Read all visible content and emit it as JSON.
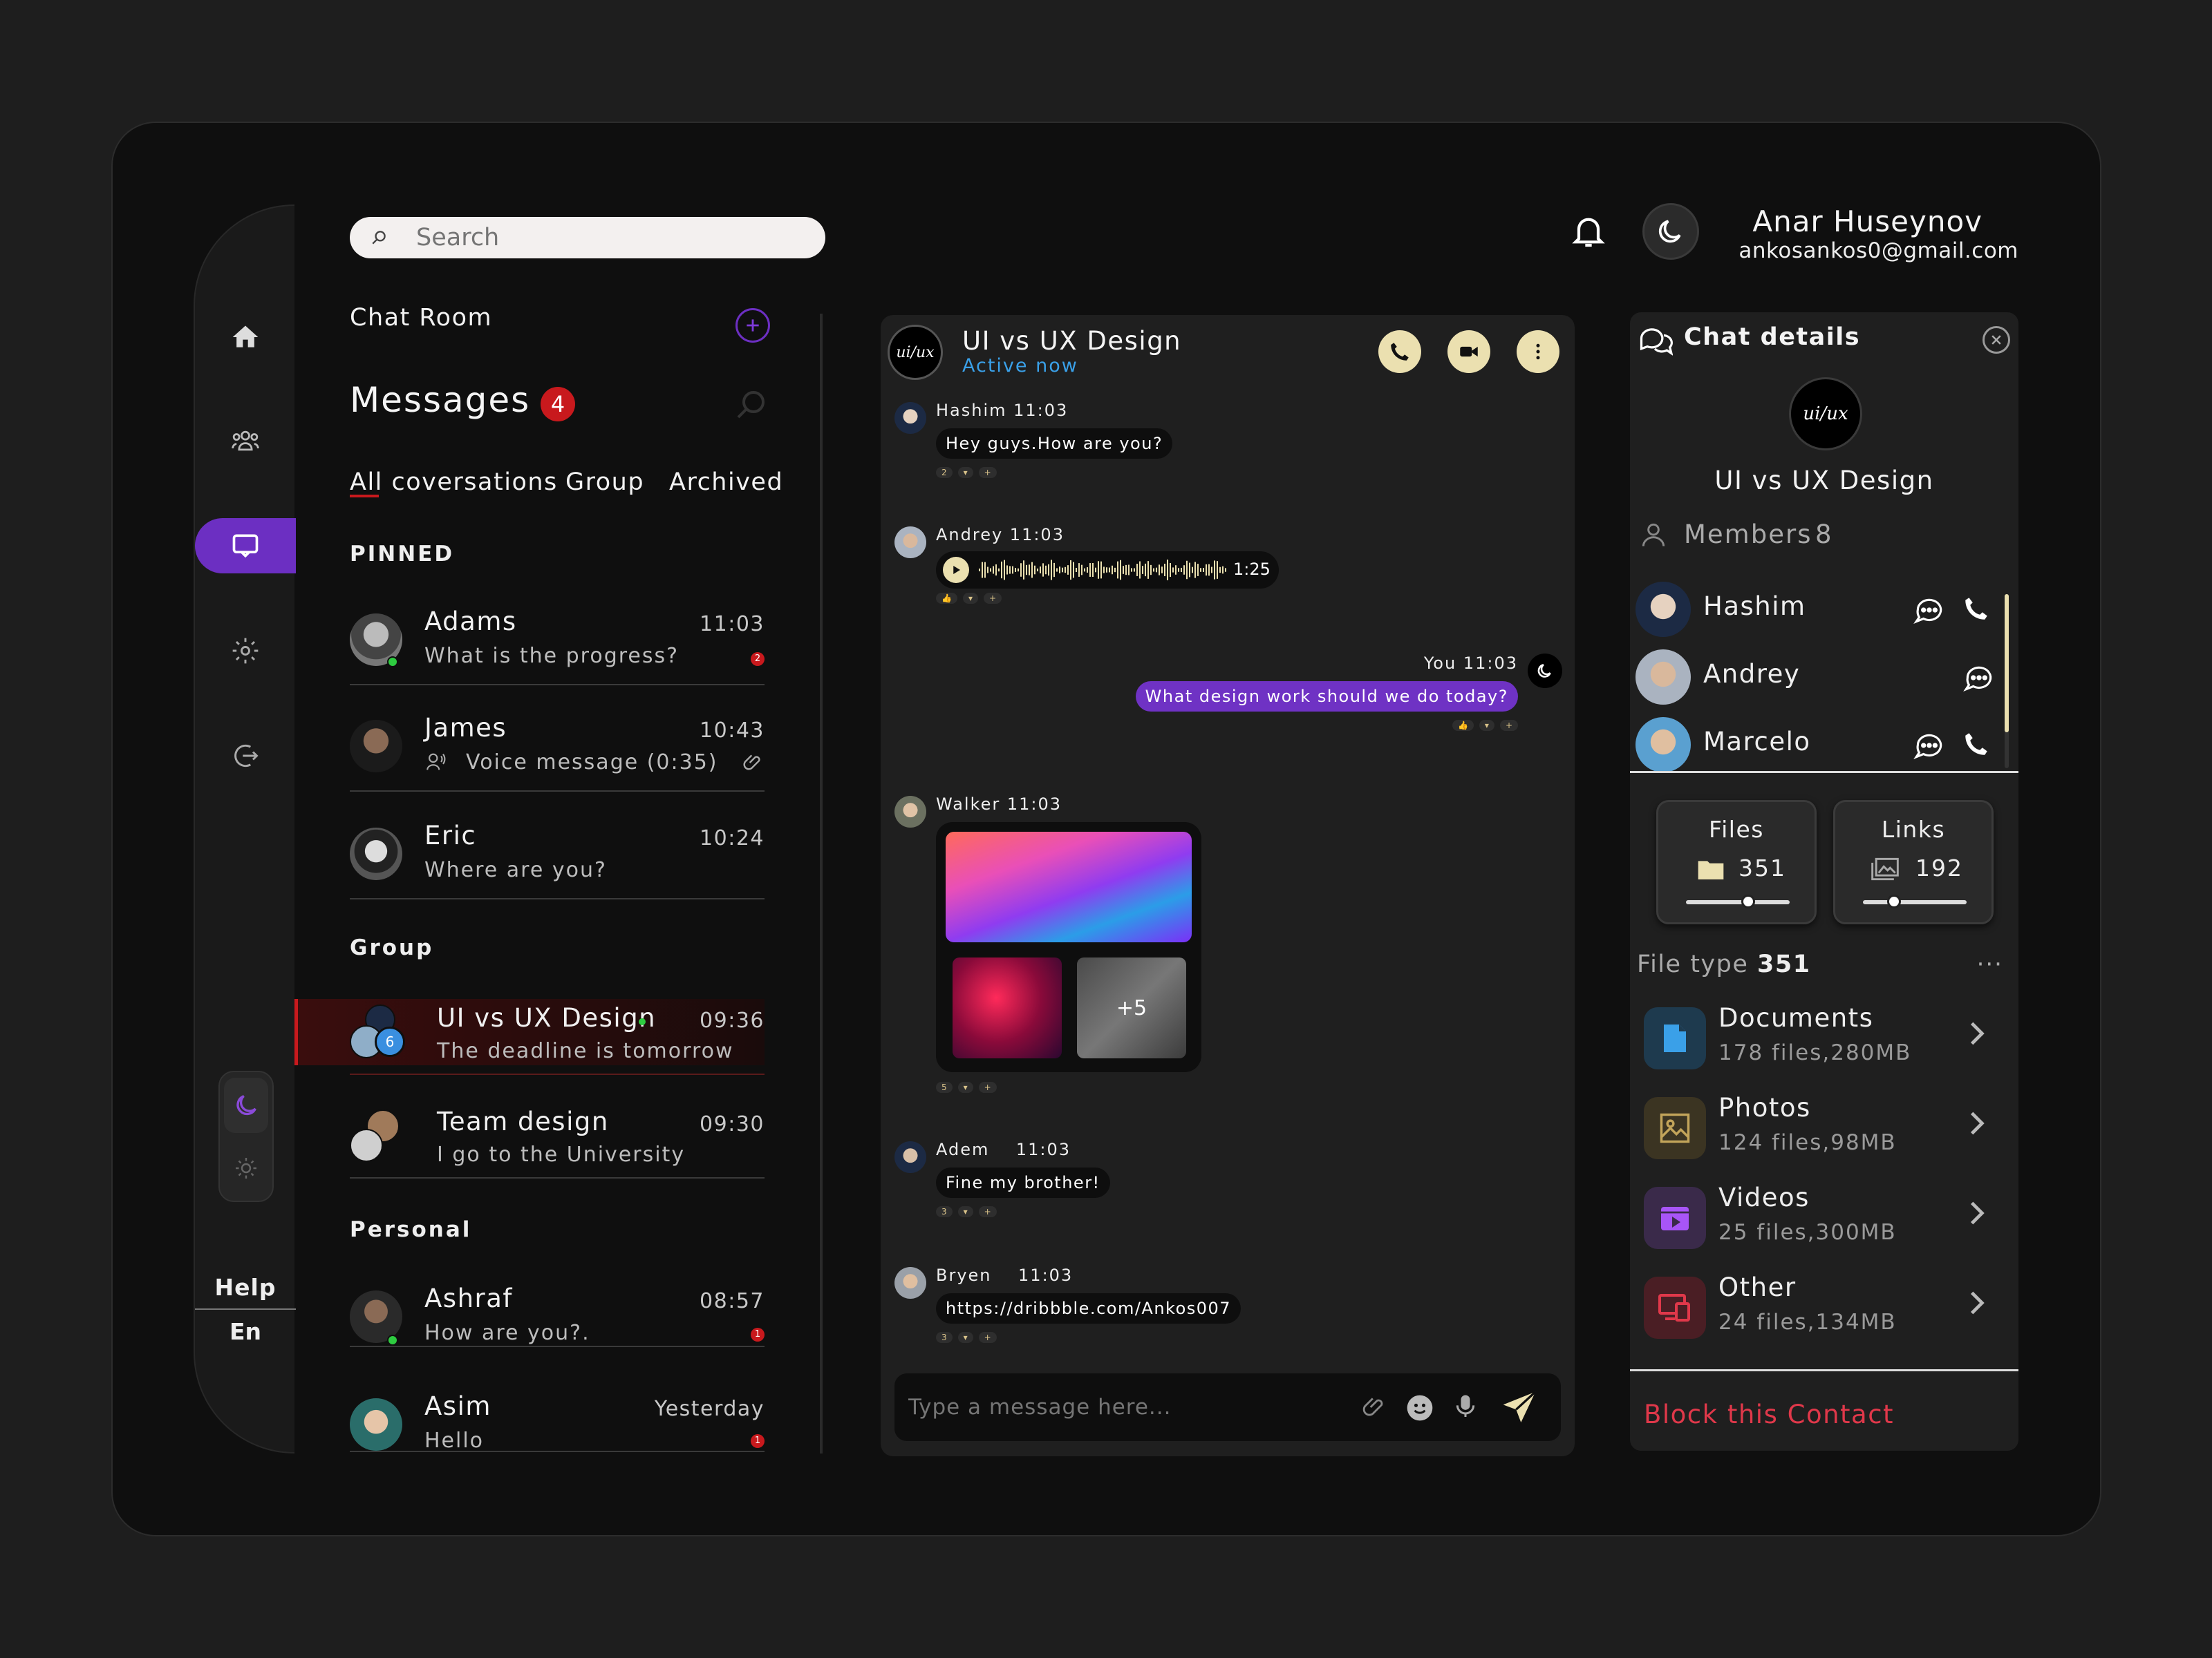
{
  "user": {
    "name": "Anar Huseynov",
    "email": "ankosankos0@gmail.com"
  },
  "search": {
    "placeholder": "Search"
  },
  "rail": {
    "help": "Help",
    "lang": "En"
  },
  "list": {
    "chat_room": "Chat Room",
    "messages_title": "Messages",
    "messages_count": "4",
    "tabs": [
      "All coversations",
      "Group",
      "Archived"
    ],
    "sections": {
      "pinned": "PINNED",
      "group": "Group",
      "personal": "Personal"
    },
    "pinned": [
      {
        "name": "Adams",
        "msg": "What is the progress?",
        "time": "11:03",
        "count": "2"
      },
      {
        "name": "James",
        "msg": "Voice message  (0:35)",
        "time": "10:43"
      },
      {
        "name": "Eric",
        "msg": "Where are you?",
        "time": "10:24"
      }
    ],
    "group": [
      {
        "name": "UI vs UX Design",
        "msg": "The deadline is tomorrow",
        "time": "09:36",
        "badge": "6"
      },
      {
        "name": "Team design",
        "msg": "I go to the University",
        "time": "09:30"
      }
    ],
    "personal": [
      {
        "name": "Ashraf",
        "msg": "How are you?.",
        "time": "08:57",
        "count": "1"
      },
      {
        "name": "Asim",
        "msg": "Hello",
        "time": "Yesterday",
        "count": "1"
      }
    ]
  },
  "chat": {
    "title": "UI vs UX Design",
    "status": "Active now",
    "logo_text": "ui/ux",
    "messages": [
      {
        "sender": "Hashim 11:03",
        "text": "Hey guys.How are you?",
        "likes": "2"
      },
      {
        "sender": "Andrey 11:03",
        "duration": "1:25"
      },
      {
        "sender": "You 11:03",
        "text": "What design work should we do today?"
      },
      {
        "sender": "Walker 11:03",
        "more": "+5",
        "likes": "5"
      },
      {
        "sender": "Adem    11:03",
        "text": "Fine my brother!",
        "likes": "3"
      },
      {
        "sender": "Bryen    11:03",
        "text": "https://dribbble.com/Ankos007",
        "likes": "3"
      }
    ],
    "input_placeholder": "Type a message here..."
  },
  "details": {
    "title": "Chat details",
    "group_name": "UI vs UX Design",
    "members_label": "Members",
    "members_count": "8",
    "members": [
      "Hashim",
      "Andrey",
      "Marcelo"
    ],
    "files": {
      "label": "Files",
      "value": "351",
      "level": 0.6
    },
    "links": {
      "label": "Links",
      "value": "192",
      "level": 0.3
    },
    "file_type_label": "File type",
    "file_type_count": "351",
    "types": [
      {
        "name": "Documents",
        "meta": "178 files,280MB",
        "color": "#3aa0e8"
      },
      {
        "name": "Photos",
        "meta": "124 files,98MB",
        "color": "#c2a45a"
      },
      {
        "name": "Videos",
        "meta": "25 files,300MB",
        "color": "#a855f7"
      },
      {
        "name": "Other",
        "meta": "24 files,134MB",
        "color": "#e0384a"
      }
    ],
    "block": "Block this Contact"
  },
  "colors": {
    "accent": "#6c2fc2",
    "sent_bubble": "#6f32c4",
    "danger": "#e0384a",
    "cream": "#ebe0b0"
  }
}
